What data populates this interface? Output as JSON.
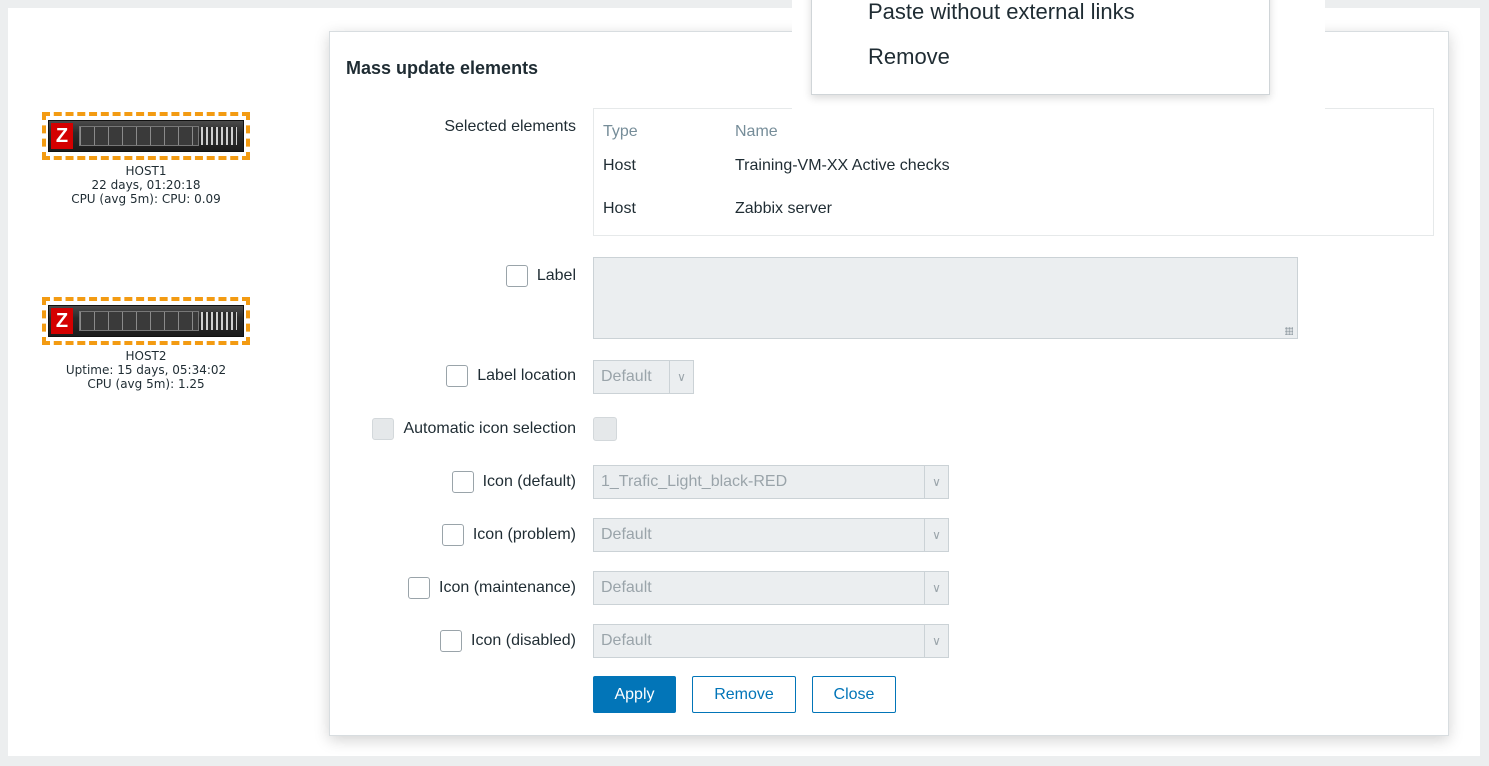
{
  "hosts": [
    {
      "name": "HOST1",
      "line2": "22 days, 01:20:18",
      "line3": "CPU (avg 5m): CPU: 0.09"
    },
    {
      "name": "HOST2",
      "line2": "Uptime: 15 days, 05:34:02",
      "line3": "CPU (avg 5m): 1.25"
    }
  ],
  "dialog": {
    "title": "Mass update elements",
    "selected_label": "Selected elements",
    "table": {
      "headers": [
        "Type",
        "Name"
      ],
      "rows": [
        {
          "type": "Host",
          "name": "Training-VM-XX Active checks"
        },
        {
          "type": "Host",
          "name": "Zabbix server"
        }
      ]
    },
    "label_label": "Label",
    "label_value": "",
    "label_location_label": "Label location",
    "label_location_value": "Default",
    "auto_icon_label": "Automatic icon selection",
    "icon_default_label": "Icon (default)",
    "icon_default_value": "1_Trafic_Light_black-RED",
    "icon_problem_label": "Icon (problem)",
    "icon_problem_value": "Default",
    "icon_maintenance_label": "Icon (maintenance)",
    "icon_maintenance_value": "Default",
    "icon_disabled_label": "Icon (disabled)",
    "icon_disabled_value": "Default",
    "buttons": {
      "apply": "Apply",
      "remove": "Remove",
      "close": "Close"
    }
  },
  "context_menu": {
    "items": [
      "Paste without external links",
      "Remove"
    ]
  },
  "colors": {
    "accent": "#0275b8",
    "selection_dash": "#f39b12"
  }
}
